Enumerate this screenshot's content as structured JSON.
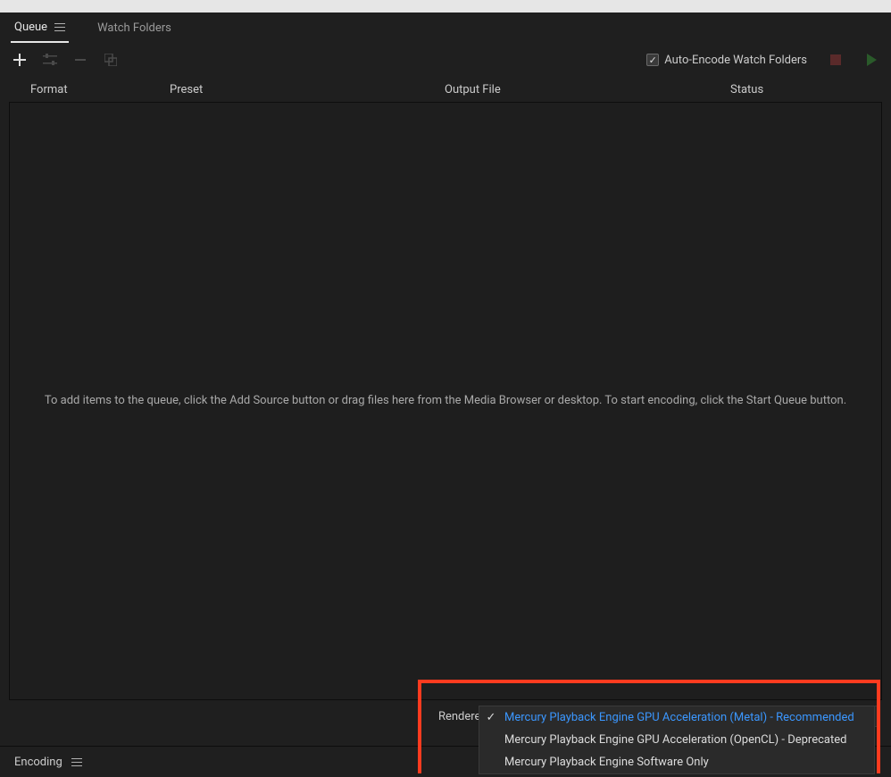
{
  "tabs": {
    "queue": "Queue",
    "watch_folders": "Watch Folders"
  },
  "toolbar": {
    "auto_encode_label": "Auto-Encode Watch Folders",
    "auto_encode_checked": true
  },
  "columns": {
    "format": "Format",
    "preset": "Preset",
    "output": "Output File",
    "status": "Status"
  },
  "queue": {
    "empty_hint": "To add items to the queue, click the Add Source button or drag files here from the Media Browser or desktop.  To start encoding, click the Start Queue button."
  },
  "renderer": {
    "label": "Renderer:",
    "current": "Mercury Playback Engine GPU Acceleration (Metal) - Recommended",
    "options": [
      "Mercury Playback Engine GPU Acceleration (Metal) - Recommended",
      "Mercury Playback Engine GPU Acceleration (OpenCL) - Deprecated",
      "Mercury Playback Engine Software Only"
    ],
    "selected_index": 0
  },
  "encoding": {
    "label": "Encoding"
  }
}
